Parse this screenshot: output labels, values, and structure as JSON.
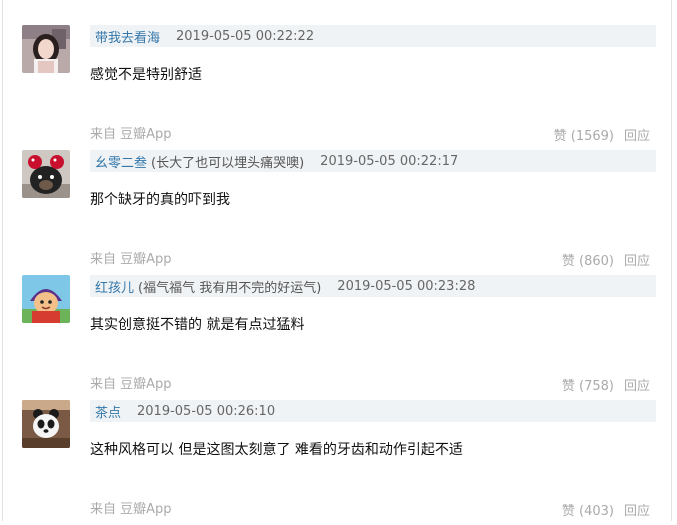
{
  "comments": [
    {
      "author": "带我去看海",
      "signature": "",
      "time": "2019-05-05 00:22:22",
      "text": "感觉不是特别舒适",
      "source": "来自 豆瓣App",
      "likes": "赞 (1569)",
      "reply": "回应",
      "avatar": "avatar-girl-photo"
    },
    {
      "author": "幺零二叁",
      "signature": "(长大了也可以埋头痛哭噢)",
      "time": "2019-05-05 00:22:17",
      "text": "那个缺牙的真的吓到我",
      "source": "来自 豆瓣App",
      "likes": "赞 (860)",
      "reply": "回应",
      "avatar": "avatar-dog-minnie-ears"
    },
    {
      "author": "红孩儿",
      "signature": "(福气福气 我有用不完的好运气)",
      "time": "2019-05-05 00:23:28",
      "text": "其实创意挺不错的 就是有点过猛料",
      "source": "来自 豆瓣App",
      "likes": "赞 (758)",
      "reply": "回应",
      "avatar": "avatar-cartoon-character"
    },
    {
      "author": "茶点",
      "signature": "",
      "time": "2019-05-05 00:26:10",
      "text": "这种风格可以 但是这图太刻意了 难看的牙齿和动作引起不适",
      "source": "来自 豆瓣App",
      "likes": "赞 (403)",
      "reply": "回应",
      "avatar": "avatar-panda-bear"
    }
  ]
}
